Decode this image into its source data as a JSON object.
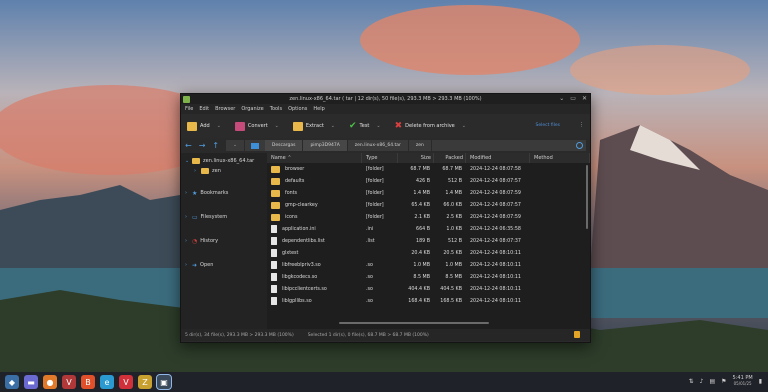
{
  "window": {
    "title": "zen.linux-x86_64.tar ( tar | 12 dir(s), 50 file(s), 293.3 MB > 293.3 MB (100%)",
    "controls": [
      "⌄",
      "▭",
      "✕"
    ]
  },
  "menubar": [
    "File",
    "Edit",
    "Browser",
    "Organize",
    "Tools",
    "Options",
    "Help"
  ],
  "toolbar": {
    "buttons": [
      {
        "label": "Add",
        "color": "#e8b84a"
      },
      {
        "label": "Convert",
        "color": "#c44b7a"
      },
      {
        "label": "Extract",
        "color": "#e8b84a"
      },
      {
        "label": "Test",
        "color": "#4cbf4a"
      },
      {
        "label": "Delete from archive",
        "color": "#d84040"
      }
    ],
    "extra_link": "Select files",
    "more": "⋮"
  },
  "address": {
    "back": "←",
    "forward": "→",
    "up": "↑",
    "segments": [
      "Descargas",
      "pimp3D947A",
      "zen.linux-x86_64.tar",
      "zen"
    ]
  },
  "sidebar": {
    "root": "zen.linux-x86_64.tar",
    "child": "zen",
    "sections": [
      "Bookmarks",
      "Filesystem",
      "History",
      "Open"
    ]
  },
  "table": {
    "headers": [
      "Name ⌃",
      "Type",
      "Size",
      "Packed",
      "Modified",
      "Method"
    ],
    "rows": [
      {
        "name": "browser",
        "type": "[folder]",
        "size": "68.7 MB",
        "packed": "68.7 MB",
        "modified": "2024-12-24 08:07:58",
        "kind": "folder"
      },
      {
        "name": "defaults",
        "type": "[folder]",
        "size": "426 B",
        "packed": "512 B",
        "modified": "2024-12-24 08:07:57",
        "kind": "folder"
      },
      {
        "name": "fonts",
        "type": "[folder]",
        "size": "1.4 MB",
        "packed": "1.4 MB",
        "modified": "2024-12-24 08:07:59",
        "kind": "folder"
      },
      {
        "name": "gmp-clearkey",
        "type": "[folder]",
        "size": "65.4 KB",
        "packed": "66.0 KB",
        "modified": "2024-12-24 08:07:57",
        "kind": "folder"
      },
      {
        "name": "icons",
        "type": "[folder]",
        "size": "2.1 KB",
        "packed": "2.5 KB",
        "modified": "2024-12-24 08:07:59",
        "kind": "folder"
      },
      {
        "name": "application.ini",
        "type": ".ini",
        "size": "664 B",
        "packed": "1.0 KB",
        "modified": "2024-12-24 06:35:58",
        "kind": "file"
      },
      {
        "name": "dependentlibs.list",
        "type": ".list",
        "size": "189 B",
        "packed": "512 B",
        "modified": "2024-12-24 08:07:37",
        "kind": "file"
      },
      {
        "name": "glxtest",
        "type": "",
        "size": "20.4 KB",
        "packed": "20.5 KB",
        "modified": "2024-12-24 08:10:11",
        "kind": "file"
      },
      {
        "name": "libfreeblpriv3.so",
        "type": ".so",
        "size": "1.0 MB",
        "packed": "1.0 MB",
        "modified": "2024-12-24 08:10:11",
        "kind": "file"
      },
      {
        "name": "libgkcodecs.so",
        "type": ".so",
        "size": "8.5 MB",
        "packed": "8.5 MB",
        "modified": "2024-12-24 08:10:11",
        "kind": "file"
      },
      {
        "name": "libipcclientcerts.so",
        "type": ".so",
        "size": "404.4 KB",
        "packed": "404.5 KB",
        "modified": "2024-12-24 08:10:11",
        "kind": "file"
      },
      {
        "name": "liblgpllibs.so",
        "type": ".so",
        "size": "168.4 KB",
        "packed": "168.5 KB",
        "modified": "2024-12-24 08:10:11",
        "kind": "file"
      }
    ]
  },
  "status": {
    "left": "5 dir(s), 34 file(s), 293.3 MB > 293.3 MB (100%)",
    "selection": "Selected 1 dir(s), 0 file(s), 68.7 MB > 68.7 MB (100%)"
  },
  "taskbar": {
    "apps": [
      {
        "icon": "app-launcher-icon",
        "glyph": "◆",
        "color": "#3a6ea5"
      },
      {
        "icon": "file-manager-icon",
        "glyph": "▬",
        "color": "#6a6ad0"
      },
      {
        "icon": "browser-icon",
        "glyph": "●",
        "color": "#e07a2a"
      },
      {
        "icon": "vivaldi-style-icon",
        "glyph": "V",
        "color": "#b03838"
      },
      {
        "icon": "brave-icon",
        "glyph": "B",
        "color": "#e0502a"
      },
      {
        "icon": "edge-icon",
        "glyph": "e",
        "color": "#2a9ad0"
      },
      {
        "icon": "vivaldi-icon",
        "glyph": "V",
        "color": "#d0303a"
      },
      {
        "icon": "zen-icon",
        "glyph": "Z",
        "color": "#c8a030"
      },
      {
        "icon": "archiver-icon",
        "glyph": "▣",
        "color": "#7fb24a"
      }
    ],
    "time": "5:41 PM",
    "date": "05/01/25"
  }
}
